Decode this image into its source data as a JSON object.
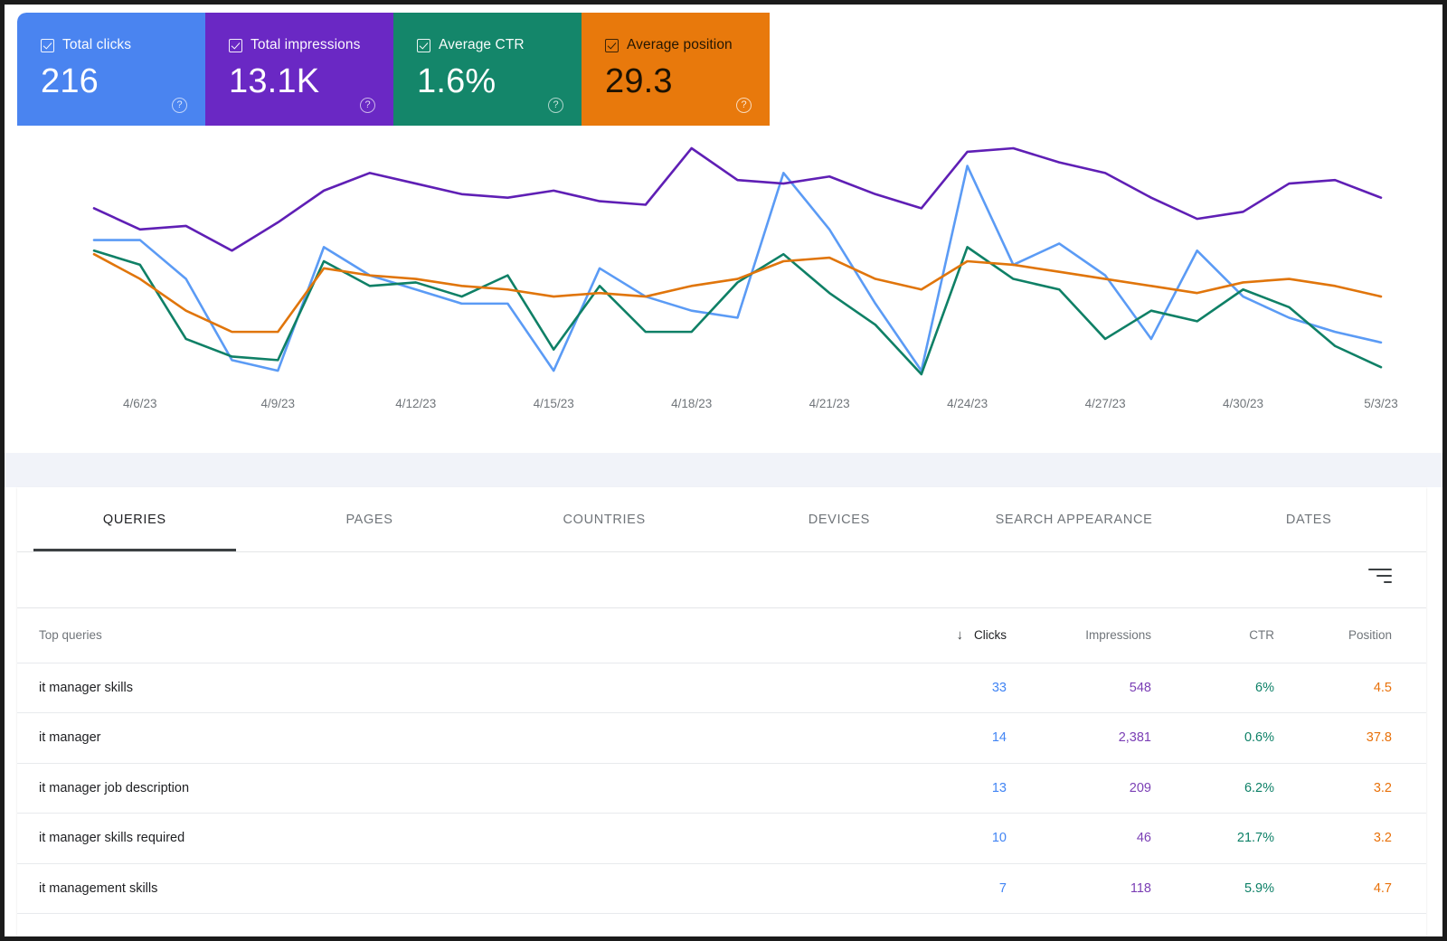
{
  "metrics": [
    {
      "label": "Total clicks",
      "value": "216",
      "color": "#4a84f0",
      "help": "?",
      "checked": true,
      "dark": false
    },
    {
      "label": "Total impressions",
      "value": "13.1K",
      "color": "#6a28c4",
      "help": "?",
      "checked": true,
      "dark": false
    },
    {
      "label": "Average CTR",
      "value": "1.6%",
      "color": "#14866a",
      "help": "?",
      "checked": true,
      "dark": false
    },
    {
      "label": "Average position",
      "value": "29.3",
      "color": "#e8790c",
      "help": "?",
      "checked": true,
      "dark": true
    }
  ],
  "chart_data": {
    "type": "line",
    "title": "",
    "xlabel": "",
    "ylabel": "",
    "grid": false,
    "legend": "none",
    "x": [
      "4/5/23",
      "4/6/23",
      "4/7/23",
      "4/8/23",
      "4/9/23",
      "4/10/23",
      "4/11/23",
      "4/12/23",
      "4/13/23",
      "4/14/23",
      "4/15/23",
      "4/16/23",
      "4/17/23",
      "4/18/23",
      "4/19/23",
      "4/20/23",
      "4/21/23",
      "4/22/23",
      "4/23/23",
      "4/24/23",
      "4/25/23",
      "4/26/23",
      "4/27/23",
      "4/28/23",
      "4/29/23",
      "4/30/23",
      "5/1/23",
      "5/2/23",
      "5/3/23"
    ],
    "tick_labels": [
      "4/6/23",
      "4/9/23",
      "4/12/23",
      "4/15/23",
      "4/18/23",
      "4/21/23",
      "4/24/23",
      "4/27/23",
      "4/30/23",
      "5/3/23"
    ],
    "series": [
      {
        "name": "Total clicks",
        "color": "#5b9bf5",
        "values": [
          54,
          54,
          43,
          20,
          17,
          52,
          44,
          40,
          36,
          36,
          17,
          46,
          38,
          34,
          32,
          73,
          57,
          36,
          17,
          75,
          47,
          53,
          44,
          26,
          51,
          38,
          32,
          28,
          25
        ]
      },
      {
        "name": "Total impressions",
        "color": "#5f1fb5",
        "values": [
          63,
          57,
          58,
          51,
          59,
          68,
          73,
          70,
          67,
          66,
          68,
          65,
          64,
          80,
          71,
          70,
          72,
          67,
          63,
          79,
          80,
          76,
          73,
          66,
          60,
          62,
          70,
          71,
          66
        ]
      },
      {
        "name": "Average CTR",
        "color": "#0f8066",
        "values": [
          51,
          47,
          26,
          21,
          20,
          48,
          41,
          42,
          38,
          44,
          23,
          41,
          28,
          28,
          42,
          50,
          39,
          30,
          16,
          52,
          43,
          40,
          26,
          34,
          31,
          40,
          35,
          24,
          18
        ]
      },
      {
        "name": "Average position",
        "color": "#e0750b",
        "values": [
          50,
          43,
          34,
          28,
          28,
          46,
          44,
          43,
          41,
          40,
          38,
          39,
          38,
          41,
          43,
          48,
          49,
          43,
          40,
          48,
          47,
          45,
          43,
          41,
          39,
          42,
          43,
          41,
          38
        ]
      }
    ]
  },
  "tabs": [
    {
      "label": "QUERIES",
      "active": true
    },
    {
      "label": "PAGES",
      "active": false
    },
    {
      "label": "COUNTRIES",
      "active": false
    },
    {
      "label": "DEVICES",
      "active": false
    },
    {
      "label": "SEARCH APPEARANCE",
      "active": false
    },
    {
      "label": "DATES",
      "active": false
    }
  ],
  "toolbar": {
    "filter_icon": "filter-icon"
  },
  "table": {
    "sort_indicator": "↓",
    "columns": {
      "query": "Top queries",
      "clicks": "Clicks",
      "impressions": "Impressions",
      "ctr": "CTR",
      "position": "Position"
    },
    "rows": [
      {
        "query": "it manager skills",
        "clicks": "33",
        "impressions": "548",
        "ctr": "6%",
        "position": "4.5"
      },
      {
        "query": "it manager",
        "clicks": "14",
        "impressions": "2,381",
        "ctr": "0.6%",
        "position": "37.8"
      },
      {
        "query": "it manager job description",
        "clicks": "13",
        "impressions": "209",
        "ctr": "6.2%",
        "position": "3.2"
      },
      {
        "query": "it manager skills required",
        "clicks": "10",
        "impressions": "46",
        "ctr": "21.7%",
        "position": "3.2"
      },
      {
        "query": "it management skills",
        "clicks": "7",
        "impressions": "118",
        "ctr": "5.9%",
        "position": "4.7"
      }
    ]
  }
}
